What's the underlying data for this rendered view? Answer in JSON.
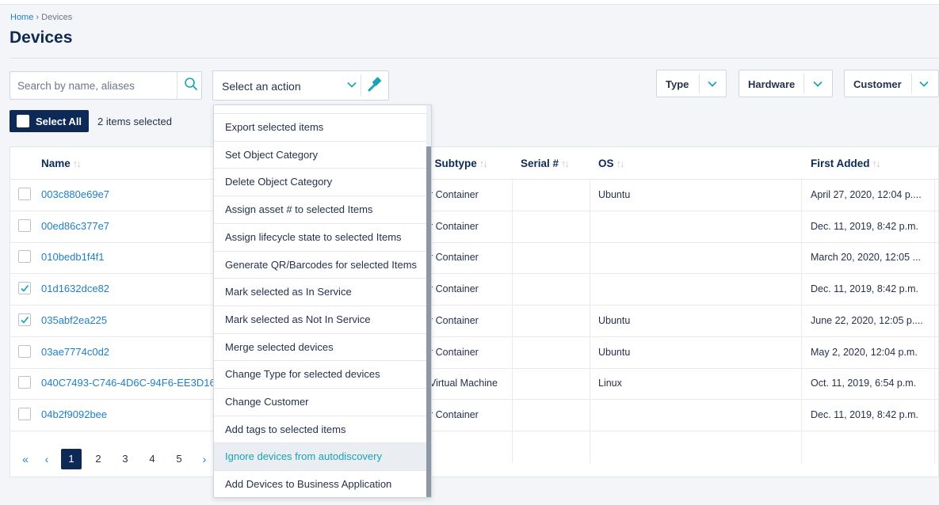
{
  "breadcrumb": {
    "home": "Home",
    "separator": "›",
    "current": "Devices"
  },
  "page": {
    "title": "Devices"
  },
  "search": {
    "placeholder": "Search by name, aliases"
  },
  "action": {
    "label": "Select an action"
  },
  "filters": [
    {
      "label": "Type"
    },
    {
      "label": "Hardware"
    },
    {
      "label": "Customer"
    }
  ],
  "selection": {
    "select_all_label": "Select All",
    "count_text": "2 items selected"
  },
  "table": {
    "columns": {
      "name": "Name",
      "subtype": "l Subtype",
      "serial": "Serial #",
      "os": "OS",
      "first_added": "First Added"
    },
    "rows": [
      {
        "name": "003c880e69e7",
        "subtype": "r Container",
        "serial": "",
        "os": "Ubuntu",
        "first_added": "April 27, 2020, 12:04 p....",
        "checked": false
      },
      {
        "name": "00ed86c377e7",
        "subtype": "r Container",
        "serial": "",
        "os": "",
        "first_added": "Dec. 11, 2019, 8:42 p.m.",
        "checked": false
      },
      {
        "name": "010bedb1f4f1",
        "subtype": "r Container",
        "serial": "",
        "os": "",
        "first_added": "March 20, 2020, 12:05 ...",
        "checked": false
      },
      {
        "name": "01d1632dce82",
        "subtype": "r Container",
        "serial": "",
        "os": "",
        "first_added": "Dec. 11, 2019, 8:42 p.m.",
        "checked": true
      },
      {
        "name": "035abf2ea225",
        "subtype": "r Container",
        "serial": "",
        "os": "Ubuntu",
        "first_added": "June 22, 2020, 12:05 p....",
        "checked": true
      },
      {
        "name": "03ae7774c0d2",
        "subtype": "r Container",
        "serial": "",
        "os": "Ubuntu",
        "first_added": "May 2, 2020, 12:04 p.m.",
        "checked": false
      },
      {
        "name": "040C7493-C746-4D6C-94F6-EE3D16",
        "subtype": "Virtual Machine",
        "serial": "",
        "os": "Linux",
        "first_added": "Oct. 11, 2019, 6:54 p.m.",
        "checked": false
      },
      {
        "name": "04b2f9092bee",
        "subtype": "r Container",
        "serial": "",
        "os": "",
        "first_added": "Dec. 11, 2019, 8:42 p.m.",
        "checked": false
      }
    ]
  },
  "pagination": {
    "first": "«",
    "prev": "‹",
    "pages": [
      "1",
      "2",
      "3",
      "4",
      "5"
    ],
    "next": "›",
    "current": "1"
  },
  "action_menu": {
    "items": [
      "Export selected items",
      "Set Object Category",
      "Delete Object Category",
      "Assign asset # to selected Items",
      "Assign lifecycle state to selected Items",
      "Generate QR/Barcodes for selected Items",
      "Mark selected as In Service",
      "Mark selected as Not In Service",
      "Merge selected devices",
      "Change Type for selected devices",
      "Change Customer",
      "Add tags to selected items",
      "Ignore devices from autodiscovery",
      "Add Devices to Business Application"
    ],
    "highlighted": "Ignore devices from autodiscovery"
  },
  "colors": {
    "brand_navy": "#0d2a57",
    "link_blue": "#1e7fc8",
    "accent_teal": "#1aa3b5"
  }
}
